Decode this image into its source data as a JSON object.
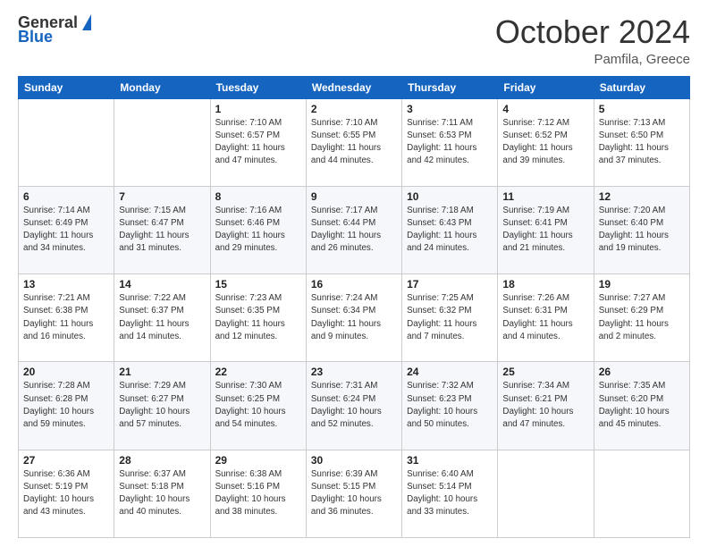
{
  "logo": {
    "general": "General",
    "blue": "Blue"
  },
  "header": {
    "month_title": "October 2024",
    "location": "Pamfila, Greece"
  },
  "days_of_week": [
    "Sunday",
    "Monday",
    "Tuesday",
    "Wednesday",
    "Thursday",
    "Friday",
    "Saturday"
  ],
  "weeks": [
    [
      {
        "day": null,
        "sunrise": null,
        "sunset": null,
        "daylight": null
      },
      {
        "day": null,
        "sunrise": null,
        "sunset": null,
        "daylight": null
      },
      {
        "day": "1",
        "sunrise": "Sunrise: 7:10 AM",
        "sunset": "Sunset: 6:57 PM",
        "daylight": "Daylight: 11 hours and 47 minutes."
      },
      {
        "day": "2",
        "sunrise": "Sunrise: 7:10 AM",
        "sunset": "Sunset: 6:55 PM",
        "daylight": "Daylight: 11 hours and 44 minutes."
      },
      {
        "day": "3",
        "sunrise": "Sunrise: 7:11 AM",
        "sunset": "Sunset: 6:53 PM",
        "daylight": "Daylight: 11 hours and 42 minutes."
      },
      {
        "day": "4",
        "sunrise": "Sunrise: 7:12 AM",
        "sunset": "Sunset: 6:52 PM",
        "daylight": "Daylight: 11 hours and 39 minutes."
      },
      {
        "day": "5",
        "sunrise": "Sunrise: 7:13 AM",
        "sunset": "Sunset: 6:50 PM",
        "daylight": "Daylight: 11 hours and 37 minutes."
      }
    ],
    [
      {
        "day": "6",
        "sunrise": "Sunrise: 7:14 AM",
        "sunset": "Sunset: 6:49 PM",
        "daylight": "Daylight: 11 hours and 34 minutes."
      },
      {
        "day": "7",
        "sunrise": "Sunrise: 7:15 AM",
        "sunset": "Sunset: 6:47 PM",
        "daylight": "Daylight: 11 hours and 31 minutes."
      },
      {
        "day": "8",
        "sunrise": "Sunrise: 7:16 AM",
        "sunset": "Sunset: 6:46 PM",
        "daylight": "Daylight: 11 hours and 29 minutes."
      },
      {
        "day": "9",
        "sunrise": "Sunrise: 7:17 AM",
        "sunset": "Sunset: 6:44 PM",
        "daylight": "Daylight: 11 hours and 26 minutes."
      },
      {
        "day": "10",
        "sunrise": "Sunrise: 7:18 AM",
        "sunset": "Sunset: 6:43 PM",
        "daylight": "Daylight: 11 hours and 24 minutes."
      },
      {
        "day": "11",
        "sunrise": "Sunrise: 7:19 AM",
        "sunset": "Sunset: 6:41 PM",
        "daylight": "Daylight: 11 hours and 21 minutes."
      },
      {
        "day": "12",
        "sunrise": "Sunrise: 7:20 AM",
        "sunset": "Sunset: 6:40 PM",
        "daylight": "Daylight: 11 hours and 19 minutes."
      }
    ],
    [
      {
        "day": "13",
        "sunrise": "Sunrise: 7:21 AM",
        "sunset": "Sunset: 6:38 PM",
        "daylight": "Daylight: 11 hours and 16 minutes."
      },
      {
        "day": "14",
        "sunrise": "Sunrise: 7:22 AM",
        "sunset": "Sunset: 6:37 PM",
        "daylight": "Daylight: 11 hours and 14 minutes."
      },
      {
        "day": "15",
        "sunrise": "Sunrise: 7:23 AM",
        "sunset": "Sunset: 6:35 PM",
        "daylight": "Daylight: 11 hours and 12 minutes."
      },
      {
        "day": "16",
        "sunrise": "Sunrise: 7:24 AM",
        "sunset": "Sunset: 6:34 PM",
        "daylight": "Daylight: 11 hours and 9 minutes."
      },
      {
        "day": "17",
        "sunrise": "Sunrise: 7:25 AM",
        "sunset": "Sunset: 6:32 PM",
        "daylight": "Daylight: 11 hours and 7 minutes."
      },
      {
        "day": "18",
        "sunrise": "Sunrise: 7:26 AM",
        "sunset": "Sunset: 6:31 PM",
        "daylight": "Daylight: 11 hours and 4 minutes."
      },
      {
        "day": "19",
        "sunrise": "Sunrise: 7:27 AM",
        "sunset": "Sunset: 6:29 PM",
        "daylight": "Daylight: 11 hours and 2 minutes."
      }
    ],
    [
      {
        "day": "20",
        "sunrise": "Sunrise: 7:28 AM",
        "sunset": "Sunset: 6:28 PM",
        "daylight": "Daylight: 10 hours and 59 minutes."
      },
      {
        "day": "21",
        "sunrise": "Sunrise: 7:29 AM",
        "sunset": "Sunset: 6:27 PM",
        "daylight": "Daylight: 10 hours and 57 minutes."
      },
      {
        "day": "22",
        "sunrise": "Sunrise: 7:30 AM",
        "sunset": "Sunset: 6:25 PM",
        "daylight": "Daylight: 10 hours and 54 minutes."
      },
      {
        "day": "23",
        "sunrise": "Sunrise: 7:31 AM",
        "sunset": "Sunset: 6:24 PM",
        "daylight": "Daylight: 10 hours and 52 minutes."
      },
      {
        "day": "24",
        "sunrise": "Sunrise: 7:32 AM",
        "sunset": "Sunset: 6:23 PM",
        "daylight": "Daylight: 10 hours and 50 minutes."
      },
      {
        "day": "25",
        "sunrise": "Sunrise: 7:34 AM",
        "sunset": "Sunset: 6:21 PM",
        "daylight": "Daylight: 10 hours and 47 minutes."
      },
      {
        "day": "26",
        "sunrise": "Sunrise: 7:35 AM",
        "sunset": "Sunset: 6:20 PM",
        "daylight": "Daylight: 10 hours and 45 minutes."
      }
    ],
    [
      {
        "day": "27",
        "sunrise": "Sunrise: 6:36 AM",
        "sunset": "Sunset: 5:19 PM",
        "daylight": "Daylight: 10 hours and 43 minutes."
      },
      {
        "day": "28",
        "sunrise": "Sunrise: 6:37 AM",
        "sunset": "Sunset: 5:18 PM",
        "daylight": "Daylight: 10 hours and 40 minutes."
      },
      {
        "day": "29",
        "sunrise": "Sunrise: 6:38 AM",
        "sunset": "Sunset: 5:16 PM",
        "daylight": "Daylight: 10 hours and 38 minutes."
      },
      {
        "day": "30",
        "sunrise": "Sunrise: 6:39 AM",
        "sunset": "Sunset: 5:15 PM",
        "daylight": "Daylight: 10 hours and 36 minutes."
      },
      {
        "day": "31",
        "sunrise": "Sunrise: 6:40 AM",
        "sunset": "Sunset: 5:14 PM",
        "daylight": "Daylight: 10 hours and 33 minutes."
      },
      {
        "day": null,
        "sunrise": null,
        "sunset": null,
        "daylight": null
      },
      {
        "day": null,
        "sunrise": null,
        "sunset": null,
        "daylight": null
      }
    ]
  ]
}
